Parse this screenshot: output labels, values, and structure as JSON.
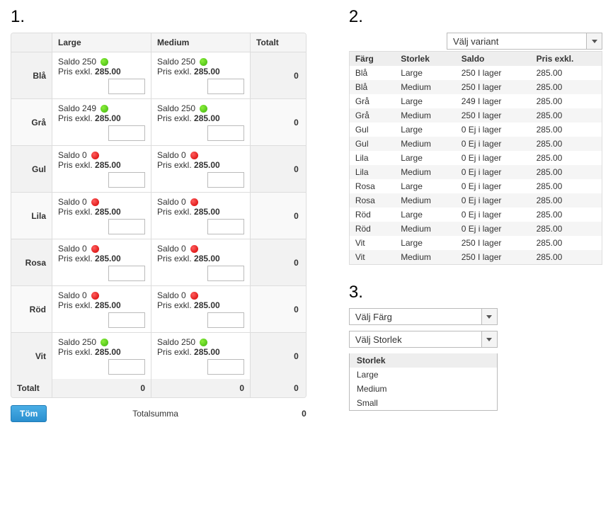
{
  "labels": {
    "section1": "1.",
    "section2": "2.",
    "section3": "3.",
    "columns": {
      "large": "Large",
      "medium": "Medium",
      "totalt": "Totalt"
    },
    "saldo_prefix": "Saldo",
    "price_prefix": "Pris exkl.",
    "totalt_row": "Totalt",
    "totalsumma": "Totalsumma",
    "totalsumma_val": "0",
    "tom": "Töm"
  },
  "grid": {
    "rows": [
      {
        "color": "Blå",
        "large": {
          "saldo": "250",
          "price": "285.00",
          "status": "green"
        },
        "medium": {
          "saldo": "250",
          "price": "285.00",
          "status": "green"
        },
        "total": "0"
      },
      {
        "color": "Grå",
        "large": {
          "saldo": "249",
          "price": "285.00",
          "status": "green"
        },
        "medium": {
          "saldo": "250",
          "price": "285.00",
          "status": "green"
        },
        "total": "0"
      },
      {
        "color": "Gul",
        "large": {
          "saldo": "0",
          "price": "285.00",
          "status": "red"
        },
        "medium": {
          "saldo": "0",
          "price": "285.00",
          "status": "red"
        },
        "total": "0"
      },
      {
        "color": "Lila",
        "large": {
          "saldo": "0",
          "price": "285.00",
          "status": "red"
        },
        "medium": {
          "saldo": "0",
          "price": "285.00",
          "status": "red"
        },
        "total": "0"
      },
      {
        "color": "Rosa",
        "large": {
          "saldo": "0",
          "price": "285.00",
          "status": "red"
        },
        "medium": {
          "saldo": "0",
          "price": "285.00",
          "status": "red"
        },
        "total": "0"
      },
      {
        "color": "Röd",
        "large": {
          "saldo": "0",
          "price": "285.00",
          "status": "red"
        },
        "medium": {
          "saldo": "0",
          "price": "285.00",
          "status": "red"
        },
        "total": "0"
      },
      {
        "color": "Vit",
        "large": {
          "saldo": "250",
          "price": "285.00",
          "status": "green"
        },
        "medium": {
          "saldo": "250",
          "price": "285.00",
          "status": "green"
        },
        "total": "0"
      }
    ],
    "foot": {
      "label": "Totalt",
      "large": "0",
      "medium": "0",
      "total": "0"
    }
  },
  "panel2": {
    "select_text": "Välj variant",
    "columns": {
      "farg": "Färg",
      "storlek": "Storlek",
      "saldo": "Saldo",
      "pris": "Pris exkl."
    },
    "rows": [
      {
        "farg": "Blå",
        "storlek": "Large",
        "saldo": "250 I lager",
        "pris": "285.00"
      },
      {
        "farg": "Blå",
        "storlek": "Medium",
        "saldo": "250 I lager",
        "pris": "285.00"
      },
      {
        "farg": "Grå",
        "storlek": "Large",
        "saldo": "249 I lager",
        "pris": "285.00"
      },
      {
        "farg": "Grå",
        "storlek": "Medium",
        "saldo": "250 I lager",
        "pris": "285.00"
      },
      {
        "farg": "Gul",
        "storlek": "Large",
        "saldo": "0 Ej i lager",
        "pris": "285.00"
      },
      {
        "farg": "Gul",
        "storlek": "Medium",
        "saldo": "0 Ej i lager",
        "pris": "285.00"
      },
      {
        "farg": "Lila",
        "storlek": "Large",
        "saldo": "0 Ej i lager",
        "pris": "285.00"
      },
      {
        "farg": "Lila",
        "storlek": "Medium",
        "saldo": "0 Ej i lager",
        "pris": "285.00"
      },
      {
        "farg": "Rosa",
        "storlek": "Large",
        "saldo": "0 Ej i lager",
        "pris": "285.00"
      },
      {
        "farg": "Rosa",
        "storlek": "Medium",
        "saldo": "0 Ej i lager",
        "pris": "285.00"
      },
      {
        "farg": "Röd",
        "storlek": "Large",
        "saldo": "0 Ej i lager",
        "pris": "285.00"
      },
      {
        "farg": "Röd",
        "storlek": "Medium",
        "saldo": "0 Ej i lager",
        "pris": "285.00"
      },
      {
        "farg": "Vit",
        "storlek": "Large",
        "saldo": "250 I lager",
        "pris": "285.00"
      },
      {
        "farg": "Vit",
        "storlek": "Medium",
        "saldo": "250 I lager",
        "pris": "285.00"
      }
    ]
  },
  "panel3": {
    "farg_select": "Välj Färg",
    "storlek_select": "Välj Storlek",
    "open_header": "Storlek",
    "options": [
      "Large",
      "Medium",
      "Small"
    ]
  }
}
